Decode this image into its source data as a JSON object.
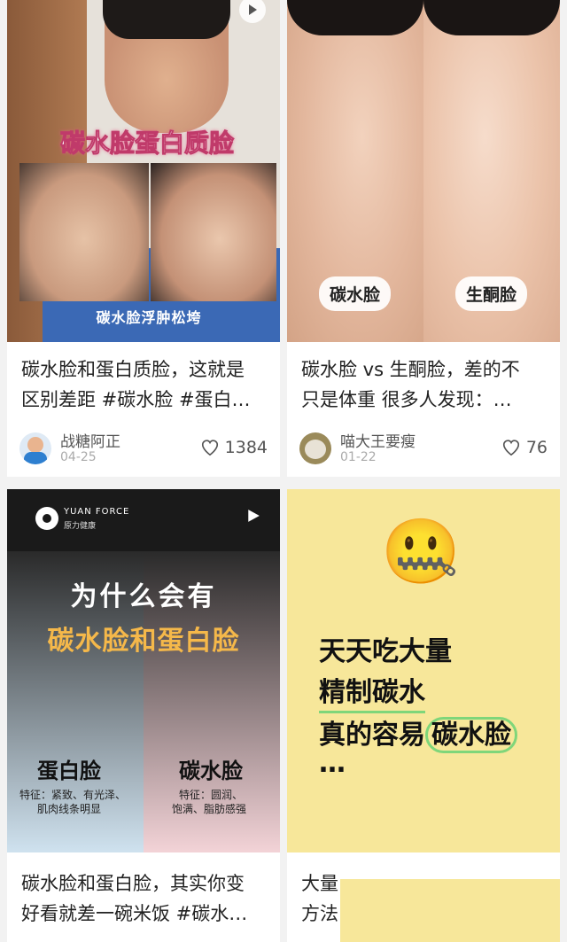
{
  "colors": {
    "page_bg": "#f2f2f2",
    "card_bg": "#ffffff",
    "highlight_yellow": "#f7e79a",
    "green_underline": "#7fd67a"
  },
  "cards": [
    {
      "overlay_title": "碳水脸蛋白质脸",
      "overlay_caption": "碳水脸浮肿松垮",
      "title_line1": "碳水脸和蛋白质脸，这就是",
      "title_line2": "区别差距 #碳水脸 #蛋白…",
      "author": "战糖阿正",
      "date": "04-25",
      "likes": "1384",
      "video": true
    },
    {
      "label_left": "碳水脸",
      "label_right": "生酮脸",
      "title_line1": "碳水脸 vs 生酮脸，差的不",
      "title_line2": "只是体重 很多人发现：…",
      "author": "喵大王要瘦",
      "date": "01-22",
      "likes": "76",
      "video": false
    },
    {
      "brand": "YUAN FORCE",
      "brand_sub": "原力健康",
      "headline1": "为什么会有",
      "headline2": "碳水脸和蛋白脸",
      "left_title": "蛋白脸",
      "left_desc1": "特征：紧致、有光泽、",
      "left_desc2": "肌肉线条明显",
      "right_title": "碳水脸",
      "right_desc1": "特征：圆润、",
      "right_desc2": "饱满、脂肪感强",
      "title_line1": "碳水脸和蛋白脸，其实你变",
      "title_line2": "好看就差一碗米饭 #碳水…",
      "video": true
    },
    {
      "emoji": "🤐",
      "line1": "天天吃大量",
      "line2": "精制碳水",
      "line3a": "真的容易",
      "line3b": "碳水脸",
      "line4": "…",
      "title_line1": "大量",
      "title_line2": "方法"
    }
  ]
}
